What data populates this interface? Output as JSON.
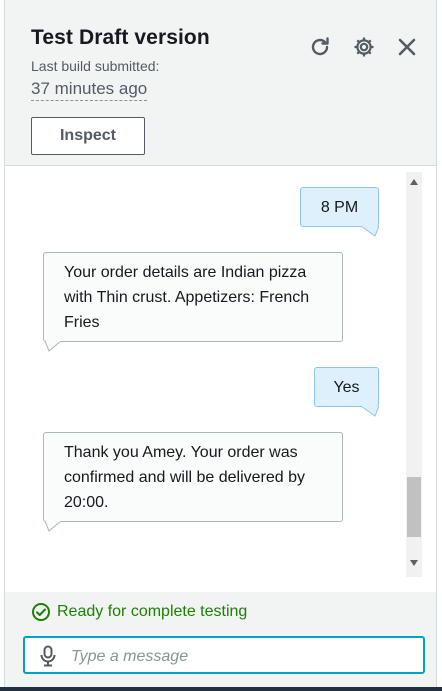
{
  "header": {
    "title": "Test Draft version",
    "subtitle": "Last build submitted:",
    "time": "37 minutes ago",
    "inspect_label": "Inspect",
    "icons": [
      "refresh-icon",
      "gear-icon",
      "close-icon"
    ]
  },
  "messages": [
    {
      "from": "user",
      "text": "8 PM"
    },
    {
      "from": "bot",
      "text": "Your order details are Indian pizza with Thin crust. Appetizers: French Fries"
    },
    {
      "from": "user",
      "text": "Yes"
    },
    {
      "from": "bot",
      "text": "Thank you Amey. Your order was confirmed and will be delivered by 20:00."
    }
  ],
  "footer": {
    "status": "Ready for complete testing",
    "input_placeholder": "Type a message",
    "input_value": ""
  },
  "colors": {
    "accent": "#00a1c9",
    "success": "#1d8102",
    "user_bubble": "#ddf0fb"
  }
}
